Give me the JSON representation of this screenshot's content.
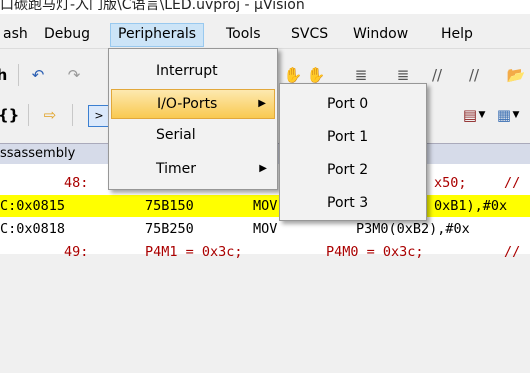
{
  "window": {
    "title": "口碳跑马灯-入门版\\C语言\\LED.uvproj - µVision"
  },
  "menubar": {
    "items": [
      "ash",
      "Debug",
      "Peripherals",
      "Tools",
      "SVCS",
      "Window",
      "Help"
    ]
  },
  "panel": {
    "title": "ssassembly"
  },
  "peripherals_menu": {
    "interrupt": "Interrupt",
    "io_ports": "I/O-Ports",
    "serial": "Serial",
    "timer": "Timer"
  },
  "io_ports_submenu": {
    "port0": "Port 0",
    "port1": "Port 1",
    "port2": "Port 2",
    "port3": "Port 3"
  },
  "disassembly": [
    {
      "addr": "",
      "code": "48:",
      "mnemonic": "",
      "operands": "x50;",
      "comment": "//"
    },
    {
      "addr": "C:0x0815",
      "code": "75B150",
      "mnemonic": "MOV",
      "operands": "0xB1),#0x",
      "comment": ""
    },
    {
      "addr": "C:0x0818",
      "code": "75B250",
      "mnemonic": "MOV",
      "operands": "P3M0(0xB2),#0x",
      "comment": ""
    },
    {
      "addr": "",
      "code": "49:",
      "mnemonic": "P4M1 = 0x3c;",
      "operands": "P4M0 = 0x3c;",
      "comment": "//"
    }
  ],
  "colors": {
    "highlight": "#ffff00",
    "menu_hover": "#f9c950",
    "source_line": "#aa0000"
  }
}
